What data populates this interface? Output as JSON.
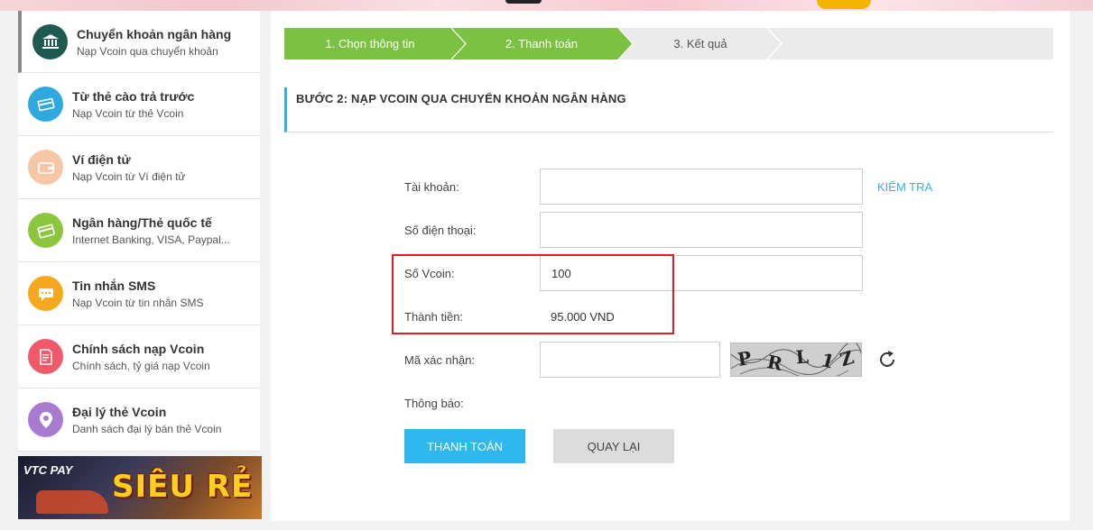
{
  "sidebar": {
    "items": [
      {
        "title": "Chuyển khoản ngân hàng",
        "sub": "Nạp Vcoin qua chuyển khoản",
        "icon": "bank-icon",
        "color": "#1f5a52",
        "active": true
      },
      {
        "title": "Từ thẻ cào trả trước",
        "sub": "Nạp Vcoin từ thẻ Vcoin",
        "icon": "card-icon",
        "color": "#2fa8e0",
        "active": false
      },
      {
        "title": "Ví điện tử",
        "sub": "Nạp Vcoin từ Ví điện tử",
        "icon": "wallet-icon",
        "color": "#f5c7a6",
        "active": false
      },
      {
        "title": "Ngân hàng/Thẻ quốc tế",
        "sub": "Internet Banking, VISA, Paypal...",
        "icon": "credit-card-icon",
        "color": "#8cc63f",
        "active": false
      },
      {
        "title": "Tin nhắn SMS",
        "sub": "Nạp Vcoin từ tin nhắn SMS",
        "icon": "chat-icon",
        "color": "#f7a81e",
        "active": false
      },
      {
        "title": "Chính sách nạp Vcoin",
        "sub": "Chính sách, tỷ giá nạp Vcoin",
        "icon": "document-icon",
        "color": "#ef5a6a",
        "active": false
      },
      {
        "title": "Đại lý thẻ Vcoin",
        "sub": "Danh sách đại lý bán thẻ Vcoin",
        "icon": "location-pin-icon",
        "color": "#a97bd0",
        "active": false
      }
    ],
    "promo": {
      "logo": "VTC PAY",
      "text": "SIÊU RẺ"
    }
  },
  "steps": [
    {
      "label": "1. Chọn thông tin",
      "state": "done"
    },
    {
      "label": "2. Thanh toán",
      "state": "active"
    },
    {
      "label": "3. Kết quả",
      "state": "pending"
    }
  ],
  "section_title": "BƯỚC 2: NẠP VCOIN QUA CHUYỂN KHOẢN NGÂN HÀNG",
  "form": {
    "account_label": "Tài khoản:",
    "account_value": "",
    "check_link": "KIỂM TRA",
    "phone_label": "Số điện thoại:",
    "phone_value": "",
    "vcoin_label": "Số Vcoin:",
    "vcoin_value": "100",
    "amount_label": "Thành tiền:",
    "amount_value": "95.000 VND",
    "captcha_label": "Mã xác nhận:",
    "captcha_value": "",
    "notice_label": "Thông báo:"
  },
  "buttons": {
    "pay": "THANH TOÁN",
    "back": "QUAY LẠI"
  },
  "colors": {
    "step_done": "#7cc242",
    "step_pending": "#ebebeb",
    "accent": "#2fb3e5",
    "highlight": "#e01e1e"
  }
}
